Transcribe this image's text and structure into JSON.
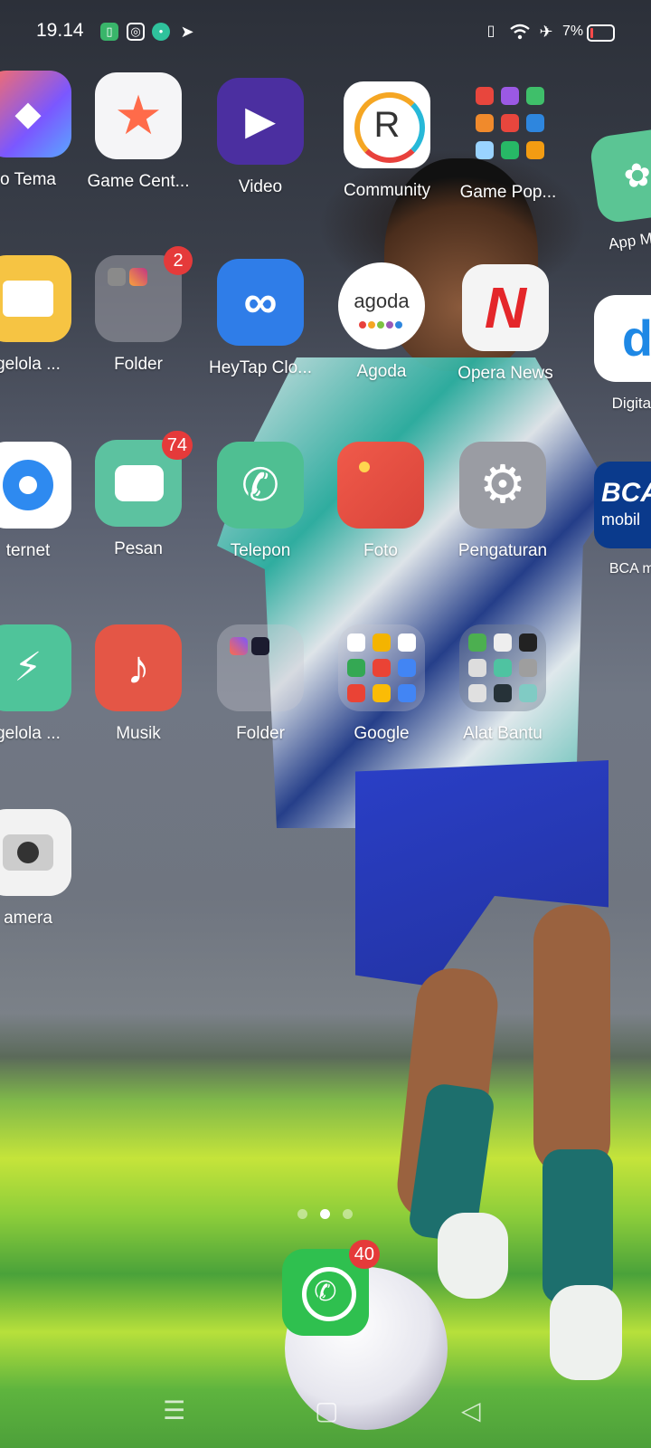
{
  "status_bar": {
    "time": "19.14",
    "battery_percent": "7%",
    "notification_icons": [
      "sim-icon",
      "instagram-icon",
      "chat-icon",
      "telegram-icon"
    ],
    "system_icons": [
      "vibrate-icon",
      "wifi-icon",
      "airplane-mode-icon",
      "battery-icon"
    ]
  },
  "apps": {
    "tema": {
      "label": "o Tema"
    },
    "game_center": {
      "label": "Game Cent..."
    },
    "video": {
      "label": "Video"
    },
    "community": {
      "label": "Community"
    },
    "game_pop": {
      "label": "Game Pop..."
    },
    "app_market": {
      "label": "App Mar"
    },
    "pengelola_file": {
      "label": "gelola ..."
    },
    "folder1": {
      "label": "Folder",
      "badge": "2"
    },
    "heytap": {
      "label": "HeyTap Clo..."
    },
    "agoda": {
      "label": "Agoda",
      "logo_text": "agoda"
    },
    "opera_news": {
      "label": "Opera News"
    },
    "digitale": {
      "label": "Digitale"
    },
    "internet": {
      "label": "ternet"
    },
    "pesan": {
      "label": "Pesan",
      "badge": "74"
    },
    "telepon": {
      "label": "Telepon"
    },
    "foto": {
      "label": "Foto"
    },
    "pengaturan": {
      "label": "Pengaturan"
    },
    "bca": {
      "label": "BCA mol",
      "logo_text": "BCA",
      "logo_sub": "mobil"
    },
    "pengelola_ponsel": {
      "label": "gelola ..."
    },
    "musik": {
      "label": "Musik"
    },
    "folder2": {
      "label": "Folder"
    },
    "google": {
      "label": "Google"
    },
    "alat_bantu": {
      "label": "Alat Bantu"
    },
    "kamera": {
      "label": "amera"
    }
  },
  "dock": {
    "whatsapp": {
      "name": "WhatsApp",
      "badge": "40"
    }
  },
  "page_indicator": {
    "total": 3,
    "current": 2
  },
  "colors": {
    "badge": "#e53a3a",
    "whatsapp": "#2fc04f",
    "telepon": "#4fbf92",
    "heytap": "#2f7de8",
    "video": "#4b2fa0",
    "musik": "#e45646"
  }
}
